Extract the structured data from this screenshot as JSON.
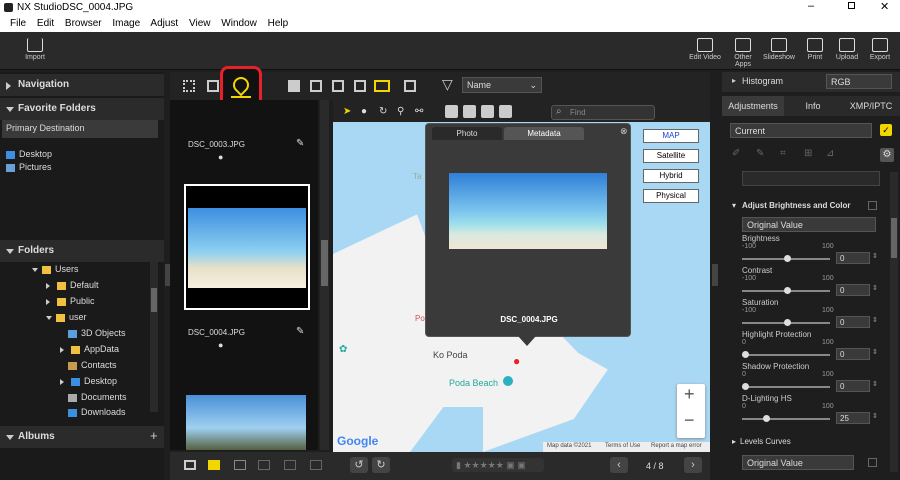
{
  "window": {
    "app_name": "NX Studio",
    "file_name": "DSC_0004.JPG"
  },
  "menu": [
    "File",
    "Edit",
    "Browser",
    "Image",
    "Adjust",
    "View",
    "Window",
    "Help"
  ],
  "toolbar": {
    "import": "Import",
    "edit_video": "Edit Video",
    "other_apps": "Other Apps",
    "slideshow": "Slideshow",
    "print": "Print",
    "upload": "Upload",
    "export": "Export"
  },
  "left": {
    "navigation": "Navigation",
    "favorite_folders": "Favorite Folders",
    "primary_destination": "Primary Destination",
    "desktop": "Desktop",
    "pictures": "Pictures",
    "folders": "Folders",
    "tree": [
      "Users",
      "Default",
      "Public",
      "user",
      "3D Objects",
      "AppData",
      "Contacts",
      "Desktop",
      "Documents",
      "Downloads"
    ],
    "albums": "Albums"
  },
  "browser": {
    "sort": "Name",
    "files": [
      "DSC_0003.JPG",
      "DSC_0004.JPG"
    ]
  },
  "map": {
    "search_placeholder": "Find",
    "popup_tab_photo": "Photo",
    "popup_tab_metadata": "Metadata",
    "popup_filename": "DSC_0004.JPG",
    "types": [
      "MAP",
      "Satellite",
      "Hybrid",
      "Physical"
    ],
    "place1": "Ko Poda",
    "place2": "Poda Beach",
    "footer": [
      "Map data ©2021",
      "Terms of Use",
      "Report a map error"
    ],
    "google": "Google",
    "zoom_in": "+",
    "zoom_out": "−",
    "partial_label1": "Ta",
    "partial_label2": "Po"
  },
  "bottom": {
    "page": "4 / 8"
  },
  "right": {
    "histogram": "Histogram",
    "histogram_mode": "RGB",
    "tabs": [
      "Adjustments",
      "Info",
      "XMP/IPTC"
    ],
    "preset": "Current",
    "section1": "Adjust Brightness and Color",
    "original": "Original Value",
    "sliders": [
      {
        "label": "Brightness",
        "min": "-100",
        "max": "100",
        "value": "0"
      },
      {
        "label": "Contrast",
        "min": "-100",
        "max": "100",
        "value": "0"
      },
      {
        "label": "Saturation",
        "min": "-100",
        "max": "100",
        "value": "0"
      },
      {
        "label": "Highlight Protection",
        "min": "0",
        "max": "100",
        "value": "0"
      },
      {
        "label": "Shadow Protection",
        "min": "0",
        "max": "100",
        "value": "0"
      },
      {
        "label": "D-Lighting HS",
        "min": "0",
        "max": "100",
        "value": "25"
      }
    ],
    "section2": "Levels  Curves",
    "original2": "Original Value"
  },
  "colors": {
    "accent_red": "#e8202a",
    "map_water": "#a9d8f4",
    "highlight_yellow": "#f2d600"
  }
}
